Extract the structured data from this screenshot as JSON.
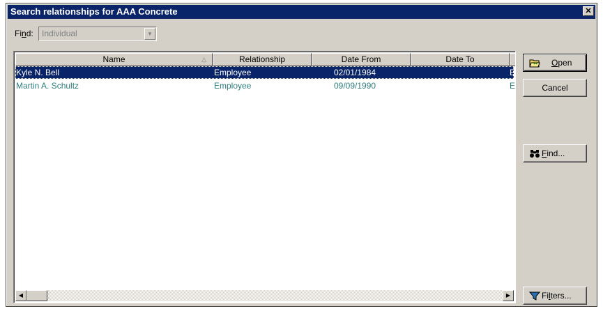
{
  "window": {
    "title": "Search relationships for AAA Concrete",
    "close": "✕"
  },
  "find": {
    "label_pre": "Fi",
    "label_key": "n",
    "label_post": "d:",
    "value": "Individual"
  },
  "grid": {
    "columns": [
      "Name",
      "Relationship",
      "Date From",
      "Date To"
    ],
    "rows": [
      {
        "name": "Kyle N. Bell",
        "relationship": "Employee",
        "date_from": "02/01/1984",
        "date_to": "",
        "extra": "E",
        "selected": true
      },
      {
        "name": "Martin A. Schultz",
        "relationship": "Employee",
        "date_from": "09/09/1990",
        "date_to": "",
        "extra": "E",
        "selected": false
      }
    ]
  },
  "buttons": {
    "open": {
      "key": "O",
      "rest": "pen"
    },
    "cancel": "Cancel",
    "find": {
      "key": "F",
      "rest": "ind..."
    },
    "filters": {
      "pre": "Fi",
      "key": "l",
      "rest": "ters..."
    }
  },
  "icons": {
    "open": "folder-open-icon",
    "find": "binoculars-icon",
    "filters": "funnel-icon"
  },
  "colors": {
    "title_bg": "#0a246a",
    "selection_bg": "#0a246a",
    "row_text": "#2e7d7d",
    "face": "#d4d0c8"
  }
}
